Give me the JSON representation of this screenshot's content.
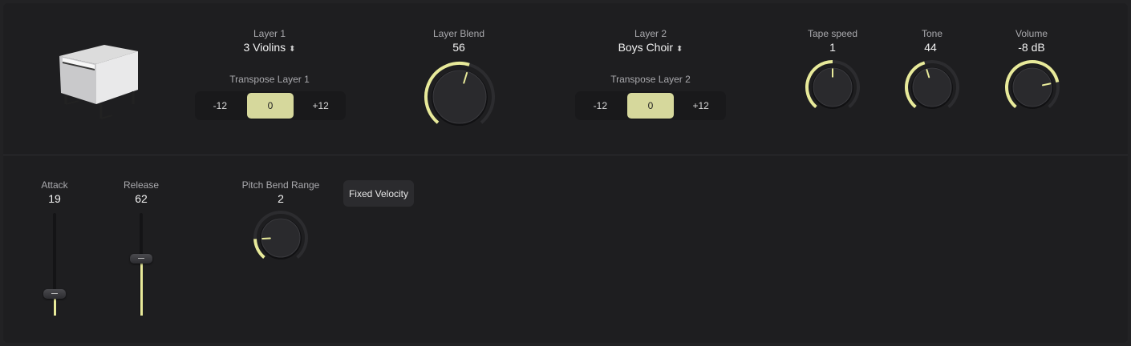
{
  "colors": {
    "accent": "#e8ea9a",
    "background": "#1e1e20",
    "segment_active": "#d6d89c"
  },
  "instrument": {
    "icon": "electric-piano-image"
  },
  "layer1": {
    "label": "Layer 1",
    "value": "3 Violins",
    "transpose_label": "Transpose Layer 1",
    "transpose_options": [
      "-12",
      "0",
      "+12"
    ],
    "transpose_selected": "0"
  },
  "layer_blend": {
    "label": "Layer Blend",
    "value": "56",
    "level": 0.56
  },
  "layer2": {
    "label": "Layer 2",
    "value": "Boys Choir",
    "transpose_label": "Transpose Layer 2",
    "transpose_options": [
      "-12",
      "0",
      "+12"
    ],
    "transpose_selected": "0"
  },
  "tape_speed": {
    "label": "Tape speed",
    "value": "1",
    "level": 0.5
  },
  "tone": {
    "label": "Tone",
    "value": "44",
    "level": 0.44
  },
  "volume": {
    "label": "Volume",
    "value": "-8 dB",
    "level": 0.78
  },
  "attack": {
    "label": "Attack",
    "value": "19",
    "level": 0.15
  },
  "release": {
    "label": "Release",
    "value": "62",
    "level": 0.49
  },
  "pitch_bend": {
    "label": "Pitch Bend Range",
    "value": "2",
    "level": 0.17
  },
  "fixed_velocity": {
    "label": "Fixed Velocity"
  }
}
